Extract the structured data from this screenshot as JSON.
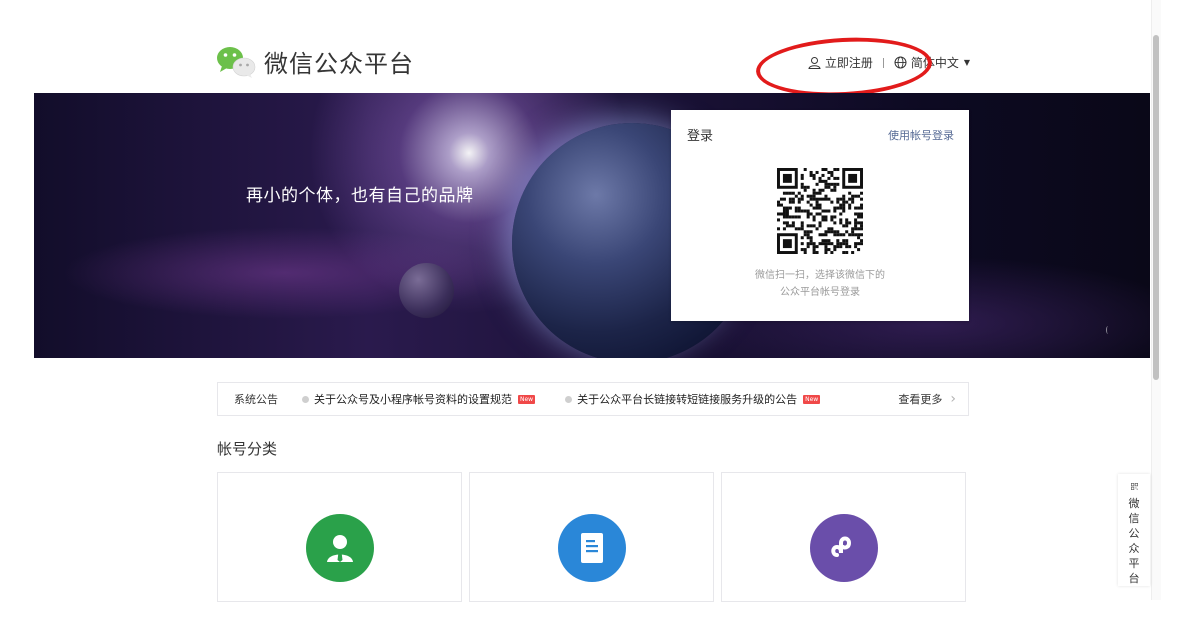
{
  "header": {
    "logo_text": "微信公众平台",
    "register_label": "立即注册",
    "language_label": "简体中文"
  },
  "banner": {
    "slogan": "再小的个体，也有自己的品牌"
  },
  "login": {
    "title": "登录",
    "switch_label": "使用帐号登录",
    "tip_line1": "微信扫一扫，选择该微信下的",
    "tip_line2": "公众平台帐号登录"
  },
  "notice": {
    "label": "系统公告",
    "items": [
      {
        "text": "关于公众号及小程序帐号资料的设置规范",
        "badge": "New"
      },
      {
        "text": "关于公众平台长链接转短链接服务升级的公告",
        "badge": "New"
      }
    ],
    "more_label": "查看更多"
  },
  "categories": {
    "title": "帐号分类",
    "cards": [
      {
        "icon": "person-icon",
        "color": "#2aa14a"
      },
      {
        "icon": "document-icon",
        "color": "#2a87d8"
      },
      {
        "icon": "mini-program-icon",
        "color": "#6a4eaa"
      }
    ]
  },
  "side_tab": {
    "label": "微信公众平台"
  }
}
